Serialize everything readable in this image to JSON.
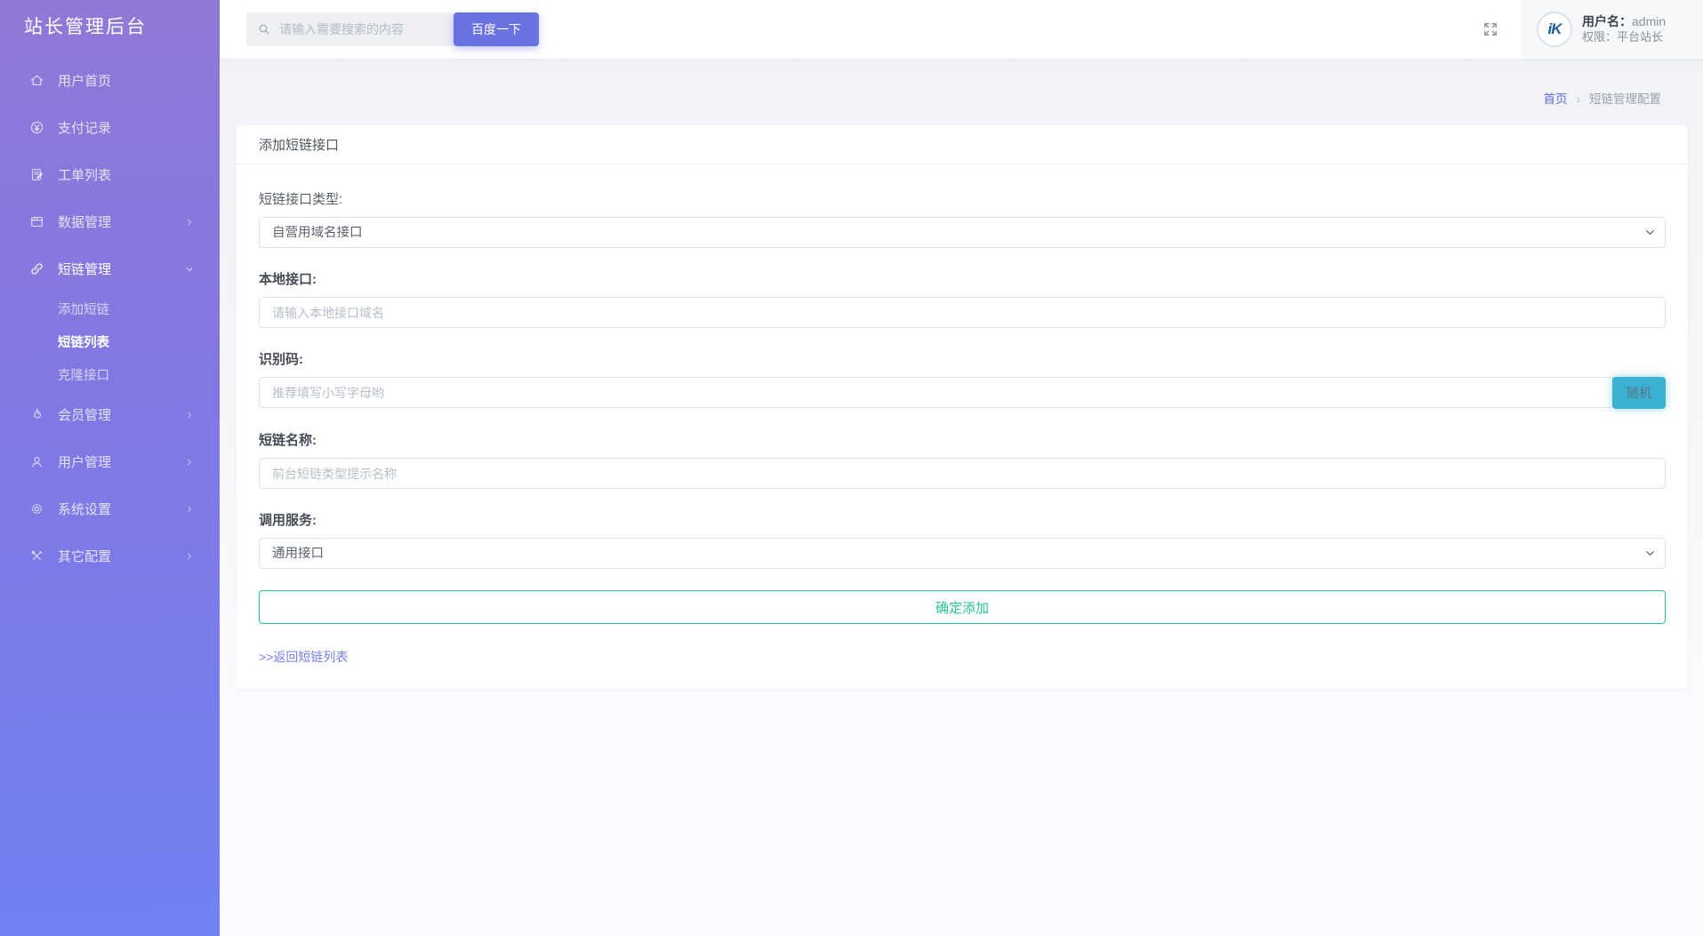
{
  "sidebar": {
    "title": "站长管理后台",
    "items": [
      {
        "label": "用户首页",
        "icon": "home-icon"
      },
      {
        "label": "支付记录",
        "icon": "yen-circle-icon"
      },
      {
        "label": "工单列表",
        "icon": "work-order-icon"
      },
      {
        "label": "数据管理",
        "icon": "data-panel-icon",
        "chevron": "right"
      },
      {
        "label": "短链管理",
        "icon": "link-icon",
        "chevron": "down",
        "active": true,
        "children": [
          {
            "label": "添加短链",
            "active": false
          },
          {
            "label": "短链列表",
            "active": true
          },
          {
            "label": "克隆接口",
            "active": false
          }
        ]
      },
      {
        "label": "会员管理",
        "icon": "flame-icon",
        "chevron": "right"
      },
      {
        "label": "用户管理",
        "icon": "user-icon",
        "chevron": "right"
      },
      {
        "label": "系统设置",
        "icon": "gear-icon",
        "chevron": "right"
      },
      {
        "label": "其它配置",
        "icon": "tools-icon",
        "chevron": "right"
      }
    ]
  },
  "topbar": {
    "search_placeholder": "请输入需要搜索的内容",
    "search_button_label": "百度一下",
    "user": {
      "avatar_logo": "iK",
      "name_label": "用户名：",
      "name": "admin",
      "role_label": "权限：",
      "role": "平台站长"
    }
  },
  "breadcrumb": {
    "home": "首页",
    "separator": "›",
    "current": "短链管理配置"
  },
  "panel": {
    "title": "添加短链接口"
  },
  "form": {
    "fields": [
      {
        "label": "短链接口类型:",
        "type": "select",
        "value": "自营用域名接口"
      },
      {
        "label": "本地接口:",
        "type": "input",
        "placeholder": "请输入本地接口域名"
      },
      {
        "label": "识别码:",
        "type": "input",
        "placeholder": "推荐填写小写字母哟",
        "button": "随机"
      },
      {
        "label": "短链名称:",
        "type": "input",
        "placeholder": "前台短链类型提示名称"
      },
      {
        "label": "调用服务:",
        "type": "select",
        "value": "通用接口"
      }
    ],
    "submit_label": "确定添加",
    "back_link": ">>返回短链列表"
  },
  "colors": {
    "sidebar_gradient_top": "#9178d6",
    "sidebar_gradient_bottom": "#7180f2",
    "primary_button": "#6a72e1",
    "random_button": "#3cb1d3",
    "submit_accent": "#26c492",
    "link": "#787ef0",
    "breadcrumb_home": "#5a68ee"
  }
}
